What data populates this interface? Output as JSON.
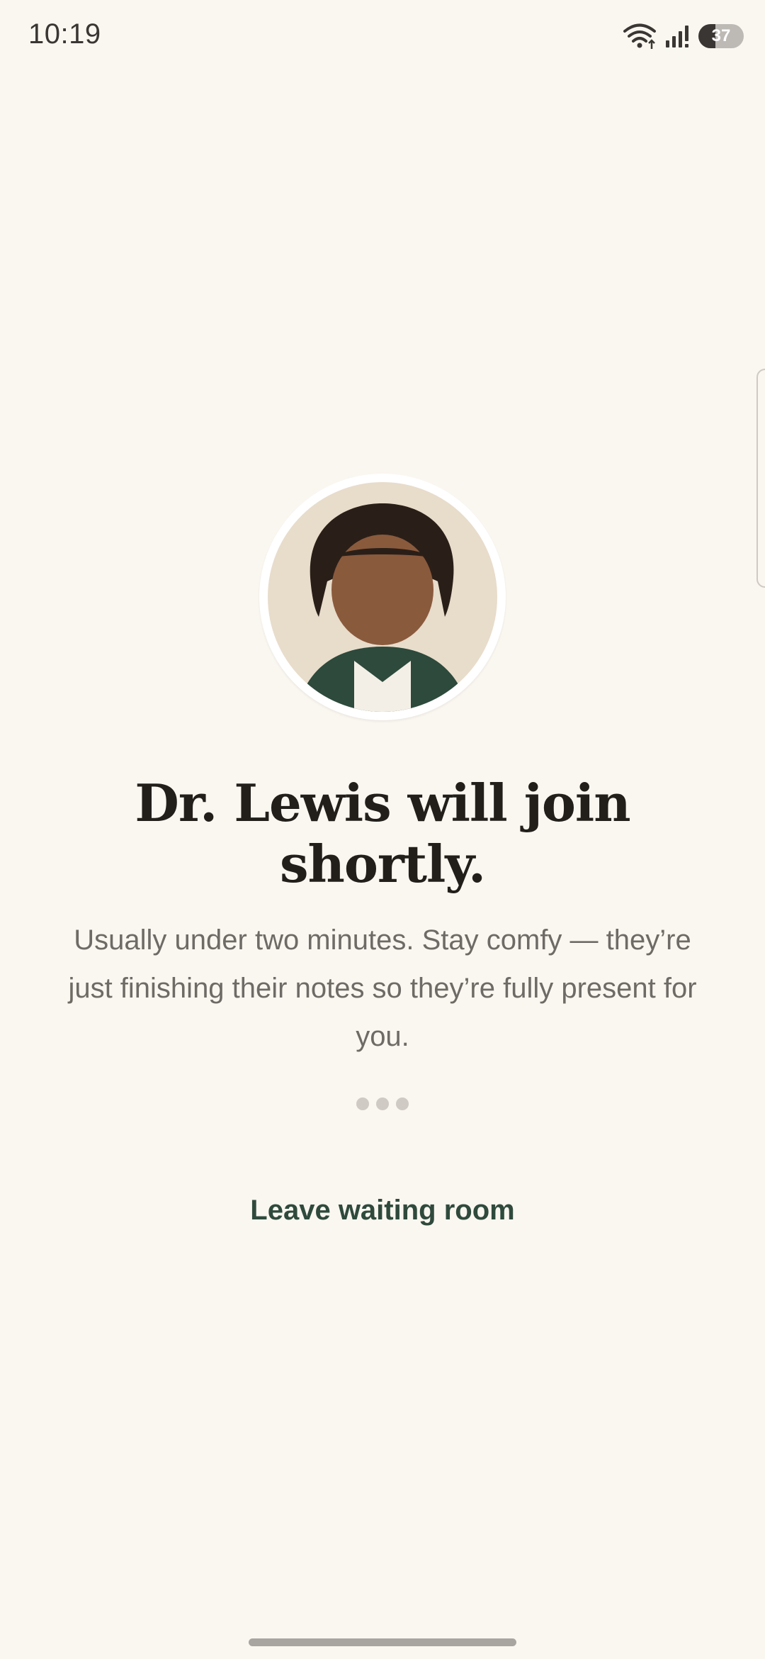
{
  "status_bar": {
    "time": "10:19",
    "battery_level": "37",
    "battery_fraction": 0.37,
    "icons": [
      "wifi-icon",
      "signal-icon",
      "battery-icon"
    ]
  },
  "avatar": {
    "icon": "doctor-avatar-illustration",
    "colors": {
      "background": "#e8dccb",
      "hair": "#2a1f18",
      "skin": "#8a5a3c",
      "shirt": "#2d4a3c",
      "collar": "#f4efe6"
    }
  },
  "main": {
    "title": "Dr. Lewis will join shortly.",
    "subtitle": "Usually under two minutes. Stay comfy — they’re just finishing their notes so they’re fully present for you.",
    "loading_icon": "typing-dots-icon"
  },
  "actions": {
    "leave_label": "Leave waiting room"
  },
  "colors": {
    "background": "#faf6f0",
    "accent": "#2f4a3c",
    "title": "#221e1a",
    "body_text": "#6e6a65"
  }
}
